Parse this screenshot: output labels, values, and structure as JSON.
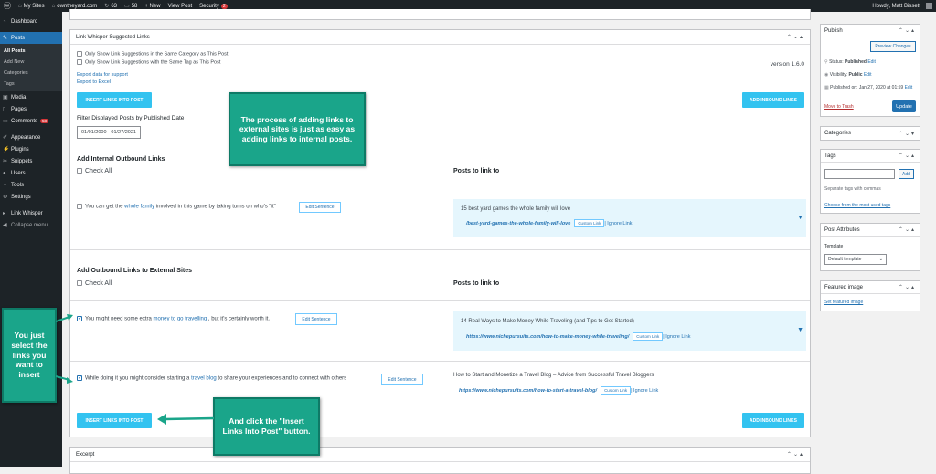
{
  "adminbar": {
    "my_sites": "My Sites",
    "site": "owntheyard.com",
    "updates": "63",
    "comments": "58",
    "new": "+ New",
    "view_post": "View Post",
    "security": "Security",
    "security_count": "2",
    "howdy": "Howdy, Matt Bissett"
  },
  "sidebar": {
    "dashboard": "Dashboard",
    "posts": "Posts",
    "sub": [
      "All Posts",
      "Add New",
      "Categories",
      "Tags"
    ],
    "media": "Media",
    "pages": "Pages",
    "comments": "Comments",
    "comments_count": "58",
    "appearance": "Appearance",
    "plugins": "Plugins",
    "snippets": "Snippets",
    "users": "Users",
    "tools": "Tools",
    "settings": "Settings",
    "link_whisper": "Link Whisper",
    "collapse": "Collapse menu"
  },
  "lw": {
    "title": "Link Whisper Suggested Links",
    "only_same_cat": "Only Show Link Suggestions in the Same Category as This Post",
    "only_same_tag": "Only Show Link Suggestions with the Same Tag as This Post",
    "export_support": "Export data for support",
    "export_excel": "Export to Excel",
    "version": "version 1.6.0",
    "insert_btn": "INSERT LINKS INTO POST",
    "inbound_btn": "ADD INBOUND LINKS",
    "filter_label": "Filter Displayed Posts by Published Date",
    "date_range": "01/01/2000 - 01/27/2021",
    "internal_heading": "Add Internal Outbound Links",
    "check_all": "Check All",
    "posts_to_link": "Posts to link to",
    "internal_row": {
      "before": "You can get the ",
      "anchor": "whole family",
      "after": " involved in this game by taking turns on who's \"it\"",
      "edit": "Edit Sentence",
      "post_title": "15 best yard games the whole family will love",
      "url": "/best-yard-games-the-whole-family-will-love",
      "custom": "Custom Link",
      "ignore": "| Ignore Link"
    },
    "external_heading": "Add Outbound Links to External Sites",
    "ext_row1": {
      "before": "You might need some extra ",
      "anchor": "money to go travelling",
      "after": " , but it's certainly worth it.",
      "edit": "Edit Sentence",
      "post_title": "14 Real Ways to Make Money While Traveling (and Tips to Get Started)",
      "url": "https://www.nichepursuits.com/how-to-make-money-while-traveling/",
      "custom": "Custom Link",
      "ignore": "| Ignore Link"
    },
    "ext_row2": {
      "before": "While doing it you might consider starting a ",
      "anchor": "travel blog",
      "after": " to share your experiences and to connect with others",
      "edit": "Edit Sentence",
      "post_title": "How to Start and Monetize a Travel Blog – Advice from Successful Travel Bloggers",
      "url": "https://www.nichepursuits.com/how-to-start-a-travel-blog/",
      "custom": "Custom Link",
      "ignore": "| Ignore Link"
    }
  },
  "excerpt": "Excerpt",
  "callouts": {
    "top": "The process of adding links to external sites is just as easy as adding links to internal posts.",
    "left": "You just select the links you want to insert",
    "bottom": "And click the \"Insert Links Into Post\" button."
  },
  "publish": {
    "title": "Publish",
    "preview": "Preview Changes",
    "status_label": "Status: ",
    "status_value": "Published",
    "visibility_label": "Visibility: ",
    "visibility_value": "Public",
    "published_on": "Published on: Jan 27, 2020 at 01:59",
    "edit": "Edit",
    "trash": "Move to Trash",
    "update": "Update"
  },
  "categories_title": "Categories",
  "tags": {
    "title": "Tags",
    "add": "Add",
    "help": "Separate tags with commas",
    "choose": "Choose from the most used tags"
  },
  "attributes": {
    "title": "Post Attributes",
    "template_label": "Template",
    "template_value": "Default template"
  },
  "featured": {
    "title": "Featured image",
    "set": "Set featured image"
  },
  "colors": {
    "accent": "#33c3f0",
    "callout": "#1aa58a",
    "wp_blue": "#2271b1",
    "admin_dark": "#1d2327"
  }
}
